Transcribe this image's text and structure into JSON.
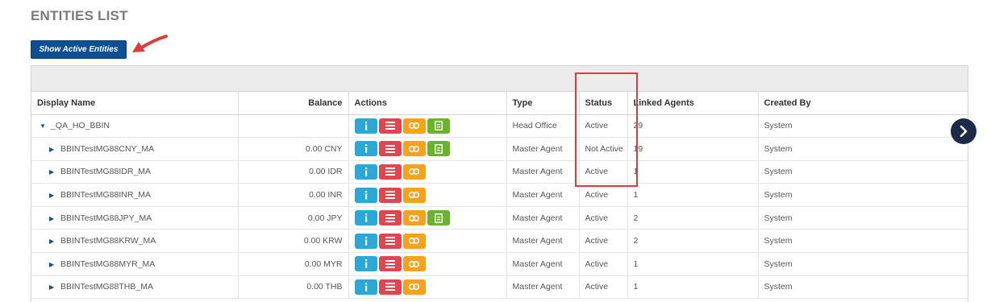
{
  "page": {
    "title": "ENTITIES LIST"
  },
  "toolbar": {
    "show_active_label": "Show Active Entities"
  },
  "table": {
    "columns": [
      "Display Name",
      "Balance",
      "Actions",
      "Type",
      "Status",
      "Linked Agents",
      "Created By"
    ],
    "rows": [
      {
        "name": "_QA_HO_BBIN",
        "balance": "",
        "type": "Head Office",
        "status": "Active",
        "linked": "29",
        "created_by": "System",
        "actions": [
          "info-icon",
          "list-icon",
          "link-icon",
          "document-icon"
        ],
        "expanded": true,
        "level": 0
      },
      {
        "name": "BBINTestMG88CNY_MA",
        "balance": "0.00 CNY",
        "type": "Master Agent",
        "status": "Not Active",
        "linked": "19",
        "created_by": "System",
        "actions": [
          "info-icon",
          "list-icon",
          "link-icon",
          "document-icon"
        ],
        "expanded": false,
        "level": 1
      },
      {
        "name": "BBINTestMG88IDR_MA",
        "balance": "0.00 IDR",
        "type": "Master Agent",
        "status": "Active",
        "linked": "1",
        "created_by": "System",
        "actions": [
          "info-icon",
          "list-icon",
          "link-icon"
        ],
        "expanded": false,
        "level": 1
      },
      {
        "name": "BBINTestMG88INR_MA",
        "balance": "0.00 INR",
        "type": "Master Agent",
        "status": "Active",
        "linked": "1",
        "created_by": "System",
        "actions": [
          "info-icon",
          "list-icon",
          "link-icon"
        ],
        "expanded": false,
        "level": 1
      },
      {
        "name": "BBINTestMG88JPY_MA",
        "balance": "0.00 JPY",
        "type": "Master Agent",
        "status": "Active",
        "linked": "2",
        "created_by": "System",
        "actions": [
          "info-icon",
          "list-icon",
          "link-icon",
          "document-icon"
        ],
        "expanded": false,
        "level": 1
      },
      {
        "name": "BBINTestMG88KRW_MA",
        "balance": "0.00 KRW",
        "type": "Master Agent",
        "status": "Active",
        "linked": "2",
        "created_by": "System",
        "actions": [
          "info-icon",
          "list-icon",
          "link-icon"
        ],
        "expanded": false,
        "level": 1
      },
      {
        "name": "BBINTestMG88MYR_MA",
        "balance": "0.00 MYR",
        "type": "Master Agent",
        "status": "Active",
        "linked": "1",
        "created_by": "System",
        "actions": [
          "info-icon",
          "list-icon",
          "link-icon"
        ],
        "expanded": false,
        "level": 1
      },
      {
        "name": "BBINTestMG88THB_MA",
        "balance": "0.00 THB",
        "type": "Master Agent",
        "status": "Active",
        "linked": "1",
        "created_by": "System",
        "actions": [
          "info-icon",
          "list-icon",
          "link-icon"
        ],
        "expanded": false,
        "level": 1
      }
    ]
  },
  "colors": {
    "primary": "#0c4f92",
    "info": "#2aa9d8",
    "list": "#e0464f",
    "link": "#f6a21c",
    "document": "#6ab42d",
    "annotation": "#e23a3a",
    "nav_circle": "#1c2b47"
  }
}
